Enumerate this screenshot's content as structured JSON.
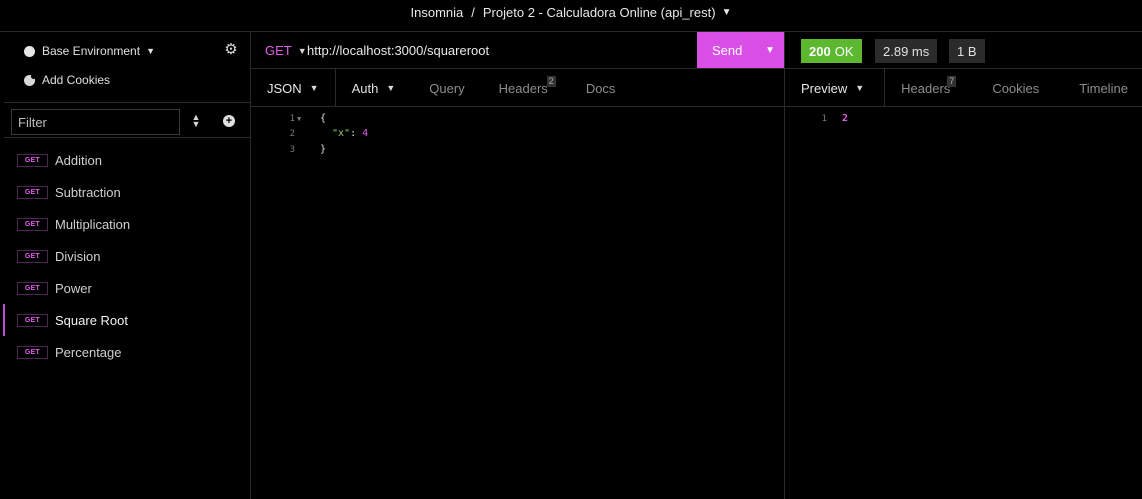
{
  "titlebar": {
    "app": "Insomnia",
    "separator": "/",
    "workspace": "Projeto 2 - Calculadora Online (api_rest)",
    "caret": "▼"
  },
  "sidebar": {
    "environment": "Base Environment",
    "add_cookies": "Add Cookies",
    "filter_placeholder": "Filter",
    "requests": [
      {
        "method": "GET",
        "name": "Addition"
      },
      {
        "method": "GET",
        "name": "Subtraction"
      },
      {
        "method": "GET",
        "name": "Multiplication"
      },
      {
        "method": "GET",
        "name": "Division"
      },
      {
        "method": "GET",
        "name": "Power"
      },
      {
        "method": "GET",
        "name": "Square Root",
        "active": true
      },
      {
        "method": "GET",
        "name": "Percentage"
      }
    ]
  },
  "request": {
    "method": "GET",
    "url": "http://localhost:3000/squareroot",
    "send_label": "Send",
    "tabs": {
      "json": "JSON",
      "auth": "Auth",
      "query": "Query",
      "headers": "Headers",
      "headers_count": "2",
      "docs": "Docs"
    },
    "body_lines": [
      {
        "n": "1",
        "open": "{"
      },
      {
        "n": "2",
        "key": "\"x\"",
        "colon": ": ",
        "value": "4"
      },
      {
        "n": "3",
        "close": "}"
      }
    ]
  },
  "response": {
    "status_code": "200",
    "status_text": "OK",
    "time": "2.89 ms",
    "size": "1 B",
    "tabs": {
      "preview": "Preview",
      "headers": "Headers",
      "headers_count": "7",
      "cookies": "Cookies",
      "timeline": "Timeline"
    },
    "line_number": "1",
    "body": "2"
  },
  "colors": {
    "accent": "#d94fe6",
    "success": "#5bb82f",
    "background": "#000000"
  },
  "icons": [
    "gear-icon",
    "cookie-icon",
    "sort-icon",
    "add-icon",
    "chevron-down-icon",
    "fold-icon"
  ]
}
